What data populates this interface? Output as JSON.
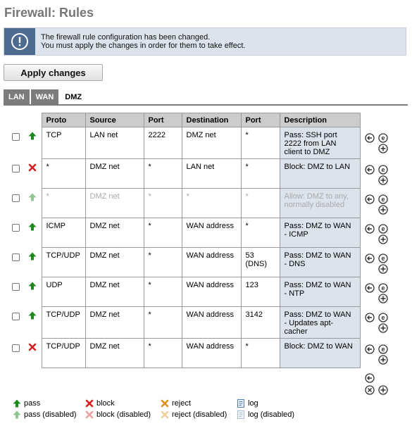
{
  "page": {
    "title": "Firewall: Rules",
    "notice": {
      "line1": "The firewall rule configuration has been changed.",
      "line2": "You must apply the changes in order for them to take effect."
    },
    "apply_label": "Apply changes"
  },
  "tabs": [
    {
      "label": "LAN",
      "active": false
    },
    {
      "label": "WAN",
      "active": false
    },
    {
      "label": "DMZ",
      "active": true
    }
  ],
  "table": {
    "headers": [
      "Proto",
      "Source",
      "Port",
      "Destination",
      "Port",
      "Description"
    ],
    "rows": [
      {
        "action": "pass",
        "enabled": true,
        "proto": "TCP",
        "source": "LAN net",
        "port": "2222",
        "destination": "DMZ net",
        "dport": "*",
        "description": "Pass: SSH port 2222 from LAN client to DMZ"
      },
      {
        "action": "block",
        "enabled": true,
        "proto": "*",
        "source": "DMZ net",
        "port": "*",
        "destination": "LAN net",
        "dport": "*",
        "description": "Block: DMZ to LAN"
      },
      {
        "action": "pass",
        "enabled": false,
        "proto": "*",
        "source": "DMZ net",
        "port": "*",
        "destination": "*",
        "dport": "*",
        "description": "Allow: DMZ to any, normally disabled"
      },
      {
        "action": "pass",
        "enabled": true,
        "proto": "ICMP",
        "source": "DMZ net",
        "port": "*",
        "destination": "WAN address",
        "dport": "*",
        "description": "Pass: DMZ to WAN - ICMP"
      },
      {
        "action": "pass",
        "enabled": true,
        "proto": "TCP/UDP",
        "source": "DMZ net",
        "port": "*",
        "destination": "WAN address",
        "dport": "53 (DNS)",
        "description": "Pass: DMZ to WAN - DNS"
      },
      {
        "action": "pass",
        "enabled": true,
        "proto": "UDP",
        "source": "DMZ net",
        "port": "*",
        "destination": "WAN address",
        "dport": "123",
        "description": "Pass: DMZ to WAN - NTP"
      },
      {
        "action": "pass",
        "enabled": true,
        "proto": "TCP/UDP",
        "source": "DMZ net",
        "port": "*",
        "destination": "WAN address",
        "dport": "3142",
        "description": "Pass: DMZ to WAN - Updates apt-cacher"
      },
      {
        "action": "block",
        "enabled": true,
        "proto": "TCP/UDP",
        "source": "DMZ net",
        "port": "*",
        "destination": "WAN address",
        "dport": "*",
        "description": "Block: DMZ to WAN"
      }
    ]
  },
  "row_buttons": [
    "move-selected-icon",
    "edit-icon",
    "add-icon"
  ],
  "bottom_buttons": [
    "move-selected-icon",
    "delete-selected-icon",
    "add-icon"
  ],
  "legend": {
    "pass": "pass",
    "pass_disabled": "pass (disabled)",
    "block": "block",
    "block_disabled": "block (disabled)",
    "reject": "reject",
    "reject_disabled": "reject (disabled)",
    "log": "log",
    "log_disabled": "log (disabled)"
  },
  "colors": {
    "pass": "#1e8a1e",
    "block": "#d42020",
    "reject": "#e0901a",
    "accent": "#4d6a91",
    "description_bg": "#dde3ed"
  }
}
